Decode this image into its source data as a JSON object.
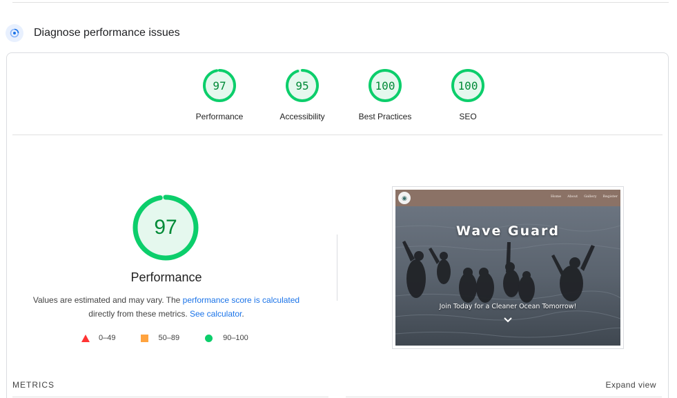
{
  "section": {
    "title": "Diagnose performance issues",
    "icon": "gauge-icon"
  },
  "categories": [
    {
      "label": "Performance",
      "score": "97"
    },
    {
      "label": "Accessibility",
      "score": "95"
    },
    {
      "label": "Best Practices",
      "score": "100"
    },
    {
      "label": "SEO",
      "score": "100"
    }
  ],
  "performance": {
    "score": "97",
    "title": "Performance",
    "note_start": "Values are estimated and may vary. The ",
    "score_link": "performance score is calculated",
    "note_mid": "directly from these metrics. ",
    "calculator_link": "See calculator",
    "note_end": "."
  },
  "legend": [
    {
      "range": "0–49",
      "shape": "triangle",
      "color": "#ff3333"
    },
    {
      "range": "50–89",
      "shape": "square",
      "color": "#ffa33f"
    },
    {
      "range": "90–100",
      "shape": "circle",
      "color": "#0cce6b"
    }
  ],
  "screenshot": {
    "site_title": "Wave Guard",
    "tagline": "Join Today for a Cleaner Ocean Tomorrow!",
    "nav": [
      "Home",
      "About",
      "Gallery",
      "Register"
    ]
  },
  "metrics": {
    "label": "METRICS",
    "expand": "Expand view"
  },
  "colors": {
    "pass": "#0cce6b",
    "pass_text": "#008a37",
    "pass_fill": "#e5f8ee",
    "link": "#1a73e8"
  }
}
